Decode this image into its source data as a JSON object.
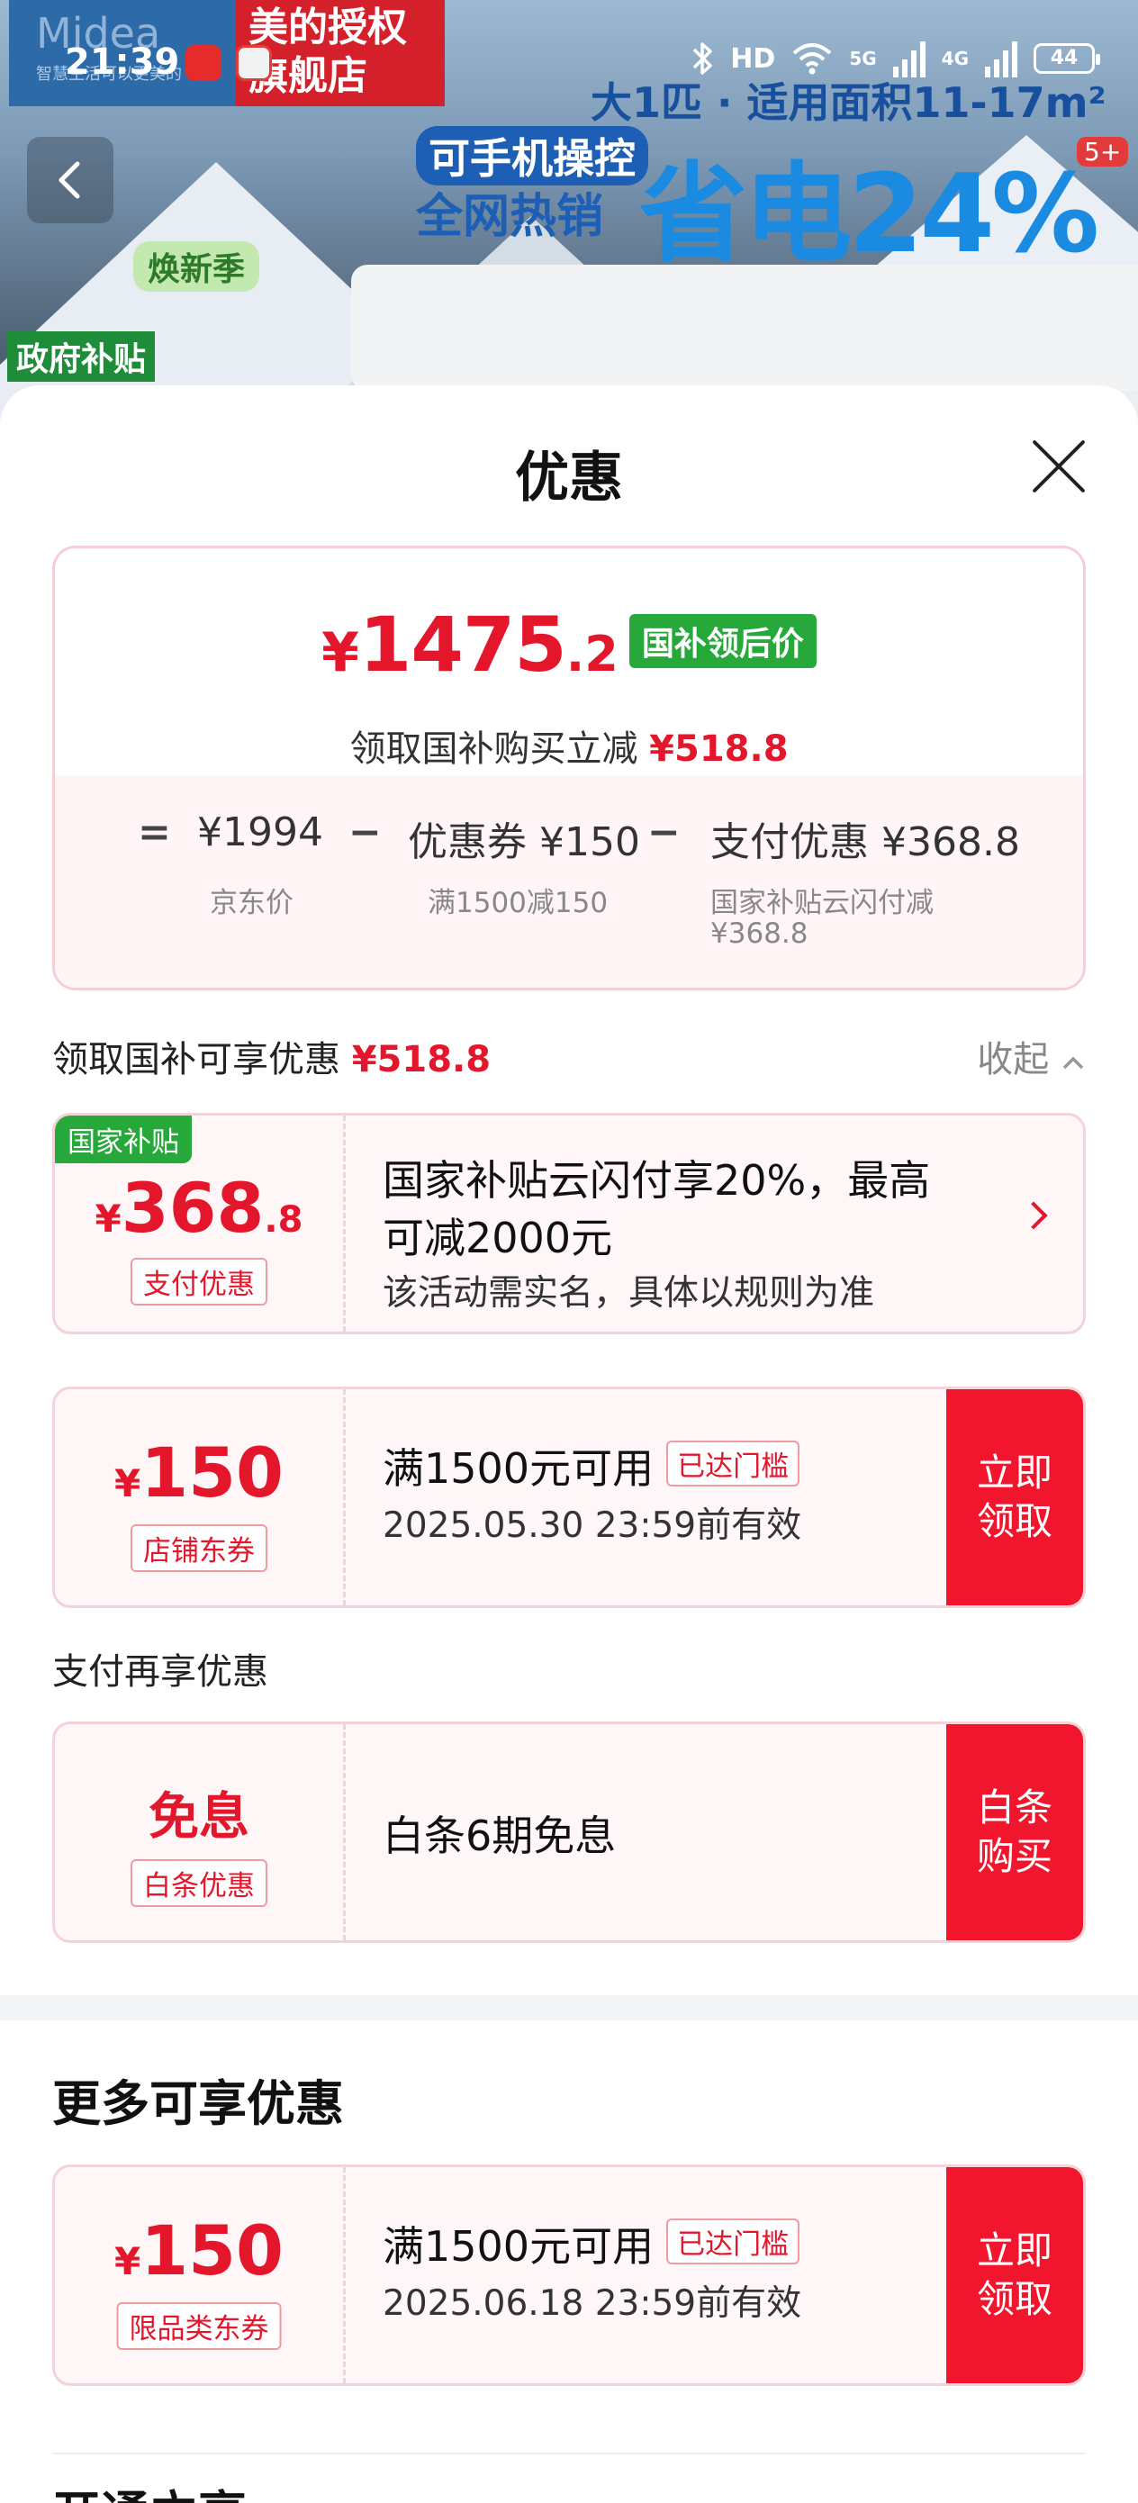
{
  "status_bar": {
    "time": "21:39",
    "network_label": "HD",
    "sig1": "5G",
    "sig2": "4G",
    "battery": "44"
  },
  "banner": {
    "brand": "Midea",
    "brand_slogan": "智慧生活可以更美的",
    "shop_name_line1": "美的授权",
    "shop_name_line2": "旗舰店",
    "slogan_area": "大1匹 · 适用面积11-17m²",
    "slogan_phone": "可手机操控",
    "slogan_hot": "全网热销",
    "slogan_save": "省电24%",
    "badge": "5+",
    "sticker_season": "焕新季",
    "sticker_gov": "政府补贴"
  },
  "sheet": {
    "title": "优惠"
  },
  "price_card": {
    "yen": "¥",
    "price_main": "1475",
    "price_dec": ".2",
    "tag": "国补领后价",
    "sub_text": "领取国补购买立减",
    "sub_amount": "¥518.8",
    "eq_sign": "=",
    "minus": "−",
    "jd_price": "¥1994",
    "jd_label": "京东价",
    "coupon_val": "优惠券 ¥150",
    "coupon_label": "满1500减150",
    "pay_val": "支付优惠 ¥368.8",
    "pay_label1": "国家补贴云闪付减",
    "pay_label2": "¥368.8"
  },
  "section1": {
    "title": "领取国补可享优惠",
    "amount": "¥518.8",
    "collapse": "收起"
  },
  "coupons": [
    {
      "corner": "国家补贴",
      "yen": "¥",
      "amount": "368",
      "dec": ".8",
      "kind": "支付优惠",
      "title_line1": "国家补贴云闪付享20%，最高",
      "title_line2": "可减2000元",
      "sub": "该活动需实名，具体以规则为准"
    },
    {
      "yen": "¥",
      "amount": "150",
      "kind": "店铺东券",
      "title": "满1500元可用",
      "chip": "已达门槛",
      "sub": "2025.05.30 23:59前有效",
      "btn1": "立即",
      "btn2": "领取"
    }
  ],
  "section2": {
    "title": "支付再享优惠"
  },
  "baitiao": {
    "amount": "免息",
    "kind": "白条优惠",
    "title": "白条6期免息",
    "btn1": "白条",
    "btn2": "购买"
  },
  "more": {
    "title": "更多可享优惠",
    "coupon": {
      "yen": "¥",
      "amount": "150",
      "kind": "限品类东券",
      "title": "满1500元可用",
      "chip": "已达门槛",
      "sub": "2025.06.18 23:59前有效",
      "btn1": "立即",
      "btn2": "领取"
    },
    "next_title": "开通立享"
  }
}
